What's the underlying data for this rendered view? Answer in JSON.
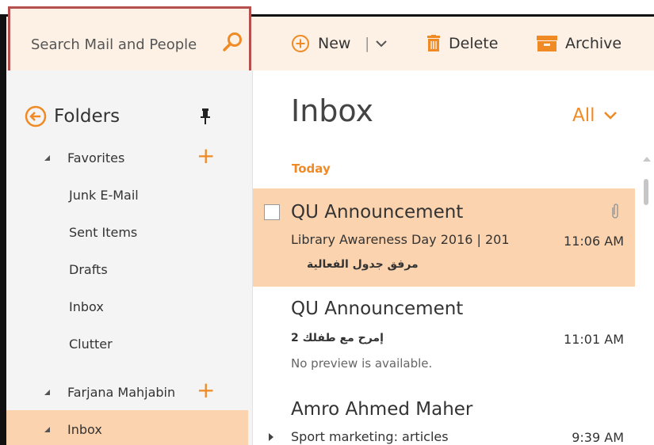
{
  "search": {
    "placeholder": "Search Mail and People"
  },
  "toolbar": {
    "new_label": "New",
    "delete_label": "Delete",
    "archive_label": "Archive"
  },
  "folders": {
    "title": "Folders",
    "favorites_label": "Favorites",
    "favorites_items": [
      "Junk E-Mail",
      "Sent Items",
      "Drafts",
      "Inbox",
      "Clutter"
    ],
    "account_label": "Farjana Mahjabin",
    "account_inbox_label": "Inbox"
  },
  "inbox": {
    "title": "Inbox",
    "filter": "All",
    "group_today": "Today",
    "messages": [
      {
        "from": "QU Announcement",
        "subject": "Library Awareness Day 2016 | 201",
        "time": "11:06 AM",
        "preview": "مرفق جدول الفعالية"
      },
      {
        "from": "QU Announcement",
        "subject": "إمرح مع طفلك 2",
        "time": "11:01 AM",
        "preview": "No preview is available."
      },
      {
        "from": "Amro Ahmed Maher",
        "subject": "Sport marketing: articles",
        "time": "9:39 AM"
      }
    ]
  },
  "colors": {
    "accent": "#f08a24",
    "selected_bg": "#fbd3ae",
    "toolbar_bg": "#fdf1e6",
    "highlight_border": "#b6504f"
  },
  "icons": [
    "search-icon",
    "plus-circle-icon",
    "chevron-down-icon",
    "trash-icon",
    "archive-icon",
    "back-arrow-icon",
    "pin-icon",
    "paperclip-icon"
  ]
}
